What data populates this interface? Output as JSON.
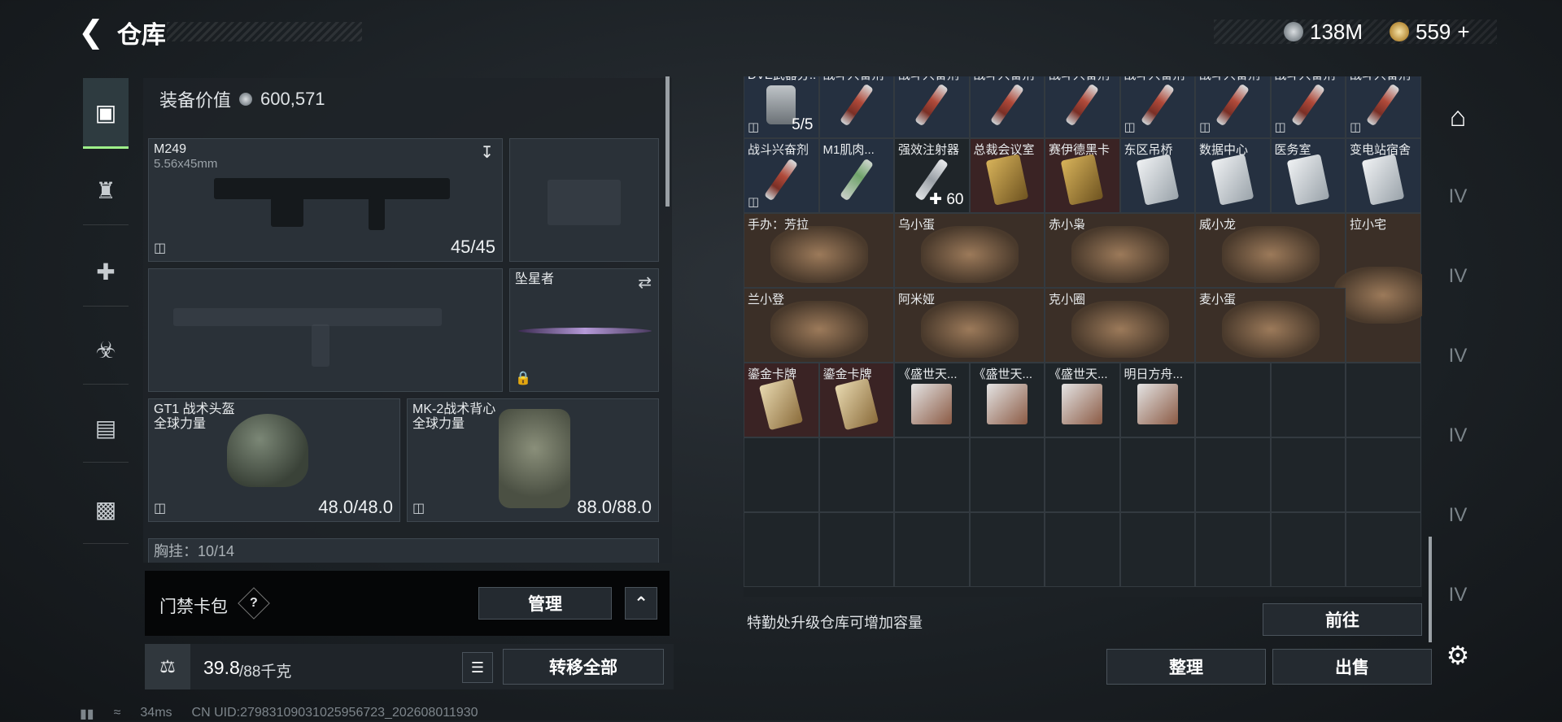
{
  "header": {
    "back_icon": "chevron-left-icon",
    "title": "仓库",
    "currencies": [
      {
        "icon": "silver-coin-icon",
        "value": "138M"
      },
      {
        "icon": "gold-coin-icon",
        "value": "559"
      }
    ],
    "add_symbol": "+"
  },
  "left_sidebar": {
    "tabs": [
      {
        "icon": "pistol-icon",
        "active": true
      },
      {
        "icon": "armor-icon",
        "active": false
      },
      {
        "icon": "medical-kit-icon",
        "active": false
      },
      {
        "icon": "backpack-icon",
        "active": false
      },
      {
        "icon": "clipboard-icon",
        "active": false
      },
      {
        "icon": "toolbox-icon",
        "active": false
      }
    ]
  },
  "equipment": {
    "value_label": "装备价值",
    "value": "600,571",
    "primary": {
      "name": "M249",
      "ammo_type": "5.56x45mm",
      "count": "45/45"
    },
    "melee": {
      "name": "坠星者"
    },
    "helmet": {
      "name": "GT1 战术头盔",
      "brand": "全球力量",
      "durability": "48.0/48.0"
    },
    "armor": {
      "name": "MK-2战术背心",
      "brand": "全球力量",
      "durability": "88.0/88.0"
    },
    "chest_rig_partial": "胸挂：10/14"
  },
  "keybag": {
    "label": "门禁卡包",
    "help": "?",
    "manage_label": "管理",
    "collapse_icon": "chevron-up-icon"
  },
  "footer_left": {
    "weight_icon": "weight-icon",
    "weight_value": "39.8",
    "weight_max": "/88千克",
    "list_icon": "list-icon",
    "transfer_all_label": "转移全部"
  },
  "grid": {
    "rows": [
      [
        {
          "name": "DVE武器分...",
          "color": "blue",
          "icon": "device-icon",
          "count": "5/5",
          "nodrop": true
        },
        {
          "name": "战斗兴奋剂",
          "color": "blue",
          "icon": "syringe-red-icon"
        },
        {
          "name": "战斗兴奋剂",
          "color": "blue",
          "icon": "syringe-red-icon"
        },
        {
          "name": "战斗兴奋剂",
          "color": "blue",
          "icon": "syringe-red-icon"
        },
        {
          "name": "战斗兴奋剂",
          "color": "blue",
          "icon": "syringe-red-icon"
        },
        {
          "name": "战斗兴奋剂",
          "color": "blue",
          "icon": "syringe-red-icon",
          "nodrop": true
        },
        {
          "name": "战斗兴奋剂",
          "color": "blue",
          "icon": "syringe-red-icon",
          "nodrop": true
        },
        {
          "name": "战斗兴奋剂",
          "color": "blue",
          "icon": "syringe-red-icon",
          "nodrop": true
        },
        {
          "name": "战斗兴奋剂",
          "color": "blue",
          "icon": "syringe-red-icon",
          "nodrop": true
        }
      ],
      [
        {
          "name": "战斗兴奋剂",
          "color": "blue",
          "icon": "syringe-red-icon",
          "nodrop": true
        },
        {
          "name": "M1肌肉...",
          "color": "blue",
          "icon": "syringe-green-icon"
        },
        {
          "name": "强效注射器",
          "color": "default",
          "icon": "syringe-white-icon",
          "count": "60",
          "plus": true
        },
        {
          "name": "总裁会议室",
          "color": "red",
          "icon": "keycard-gold-icon"
        },
        {
          "name": "赛伊德黑卡",
          "color": "red",
          "icon": "keycard-gold-icon"
        },
        {
          "name": "东区吊桥",
          "color": "blue",
          "icon": "keycard-white-icon"
        },
        {
          "name": "数据中心",
          "color": "blue",
          "icon": "keycard-white-icon"
        },
        {
          "name": "医务室",
          "color": "blue",
          "icon": "keycard-white-icon"
        },
        {
          "name": "变电站宿舍",
          "color": "blue",
          "icon": "keycard-white-icon"
        }
      ]
    ],
    "figures": [
      {
        "name": "手办：芳拉",
        "icon": "figurine-icon"
      },
      {
        "name": "乌小蛋",
        "icon": "figurine-icon"
      },
      {
        "name": "赤小枭",
        "icon": "figurine-icon"
      },
      {
        "name": "威小龙",
        "icon": "figurine-icon"
      },
      {
        "name": "拉小宅",
        "icon": "figurine-icon"
      },
      {
        "name": "兰小登",
        "icon": "figurine-icon"
      },
      {
        "name": "阿米娅",
        "icon": "figurine-icon"
      },
      {
        "name": "克小圈",
        "icon": "figurine-icon"
      },
      {
        "name": "麦小蛋",
        "icon": "figurine-icon"
      }
    ],
    "cards": [
      {
        "name": "鎏金卡牌",
        "icon": "card-icon"
      },
      {
        "name": "鎏金卡牌",
        "icon": "card-icon"
      },
      {
        "name": "《盛世天...",
        "icon": "book-icon"
      },
      {
        "name": "《盛世天...",
        "icon": "book-icon"
      },
      {
        "name": "《盛世天...",
        "icon": "book-icon"
      },
      {
        "name": "明日方舟...",
        "icon": "book-icon"
      }
    ],
    "upgrade_message": "特勤处升级仓库可增加容量",
    "goto_label": "前往",
    "sort_label": "整理",
    "sell_label": "出售"
  },
  "right_sidebar": {
    "items": [
      {
        "icon": "warehouse-icon",
        "active": true
      },
      {
        "label": "IV",
        "icon": "storage-expansion-icon"
      },
      {
        "label": "IV",
        "icon": "storage-expansion-icon"
      },
      {
        "label": "IV",
        "icon": "storage-expansion-icon"
      },
      {
        "label": "IV",
        "icon": "storage-expansion-icon"
      },
      {
        "label": "IV",
        "icon": "storage-expansion-icon"
      },
      {
        "label": "IV",
        "icon": "storage-expansion-icon"
      }
    ],
    "settings_icon": "gear-icon"
  },
  "status_bar": {
    "ping": "34ms",
    "uid": "CN UID:27983109031025956723_202608011930"
  }
}
